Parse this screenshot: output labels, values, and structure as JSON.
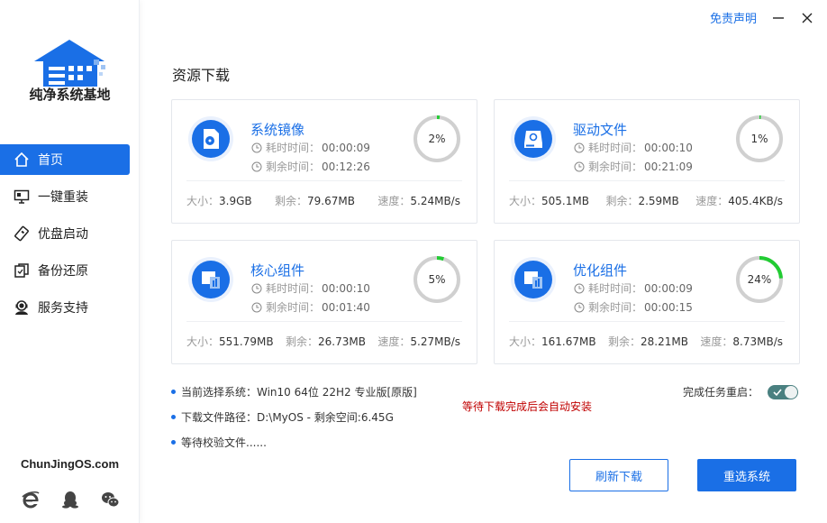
{
  "brand": {
    "name": "纯净系统基地",
    "site": "ChunJingOS.com"
  },
  "sidebar": {
    "items": [
      {
        "label": "首页",
        "icon": "home-icon"
      },
      {
        "label": "一键重装",
        "icon": "monitor-icon"
      },
      {
        "label": "优盘启动",
        "icon": "usb-icon"
      },
      {
        "label": "备份还原",
        "icon": "backup-icon"
      },
      {
        "label": "服务支持",
        "icon": "support-icon"
      }
    ]
  },
  "topbar": {
    "disclaimer": "免责声明"
  },
  "main": {
    "title": "资源下载"
  },
  "labels": {
    "elapsed": "耗时时间：",
    "remaining": "剩余时间：",
    "size": "大小：",
    "left": "剩余：",
    "speed": "速度："
  },
  "cards": [
    {
      "name": "系统镜像",
      "elapsed": "00:00:09",
      "remaining": "00:12:26",
      "size": "3.9GB",
      "left": "79.67MB",
      "speed": "5.24MB/s",
      "percent_label": "2%",
      "progress": 0.02
    },
    {
      "name": "驱动文件",
      "elapsed": "00:00:10",
      "remaining": "00:21:09",
      "size": "505.1MB",
      "left": "2.59MB",
      "speed": "405.4KB/s",
      "percent_label": "1%",
      "progress": 0.01
    },
    {
      "name": "核心组件",
      "elapsed": "00:00:10",
      "remaining": "00:01:40",
      "size": "551.79MB",
      "left": "26.73MB",
      "speed": "5.27MB/s",
      "percent_label": "5%",
      "progress": 0.05
    },
    {
      "name": "优化组件",
      "elapsed": "00:00:09",
      "remaining": "00:00:15",
      "size": "161.67MB",
      "left": "28.21MB",
      "speed": "8.73MB/s",
      "percent_label": "24%",
      "progress": 0.24
    }
  ],
  "info": {
    "system": "当前选择系统：Win10 64位 22H2 专业版[原版]",
    "path": "下载文件路径：D:\\MyOS - 剩余空间:6.45G",
    "status": "等待校验文件......",
    "warning": "等待下载完成后会自动安装",
    "restart_label": "完成任务重启："
  },
  "buttons": {
    "refresh": "刷新下载",
    "reselect": "重选系统"
  },
  "colors": {
    "accent": "#1a6fe6",
    "progress": "#22cc33",
    "warning": "#c00000"
  }
}
